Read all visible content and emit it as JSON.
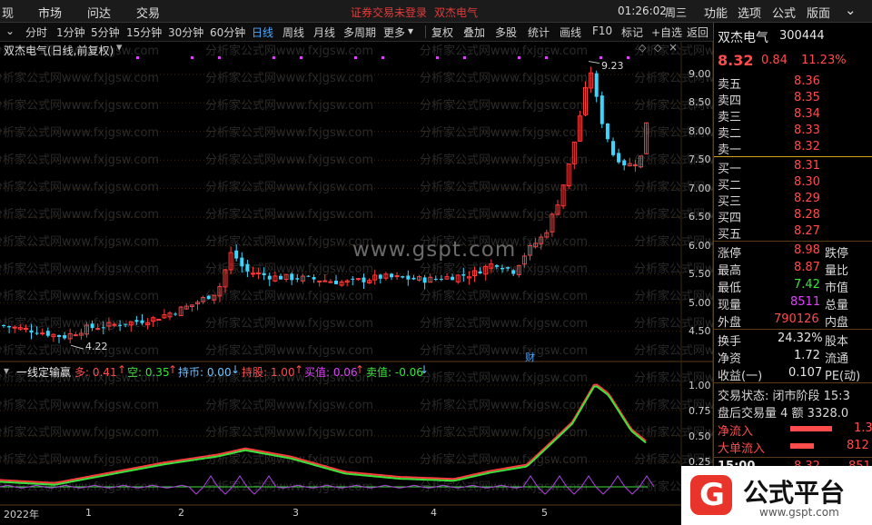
{
  "menubar": {
    "items": [
      "现",
      "市场",
      "问达",
      "交易"
    ],
    "notice": "证券交易未登录",
    "stock_name": "双杰电气",
    "time": "01:26:02",
    "weekday": "周三",
    "right_items": [
      "功能",
      "选项",
      "公式",
      "版面"
    ]
  },
  "toolbar": {
    "periods": [
      "分时",
      "1分钟",
      "5分钟",
      "15分钟",
      "30分钟",
      "60分钟",
      "日线",
      "周线",
      "月线",
      "多周期",
      "更多"
    ],
    "active_period": "日线",
    "tools": [
      "复权",
      "叠加",
      "多股",
      "统计",
      "画线",
      "F10",
      "标记",
      "+自选",
      "返回"
    ]
  },
  "chart_header": {
    "title": "双杰电气(日线,前复权)"
  },
  "indicator_header": {
    "name": "一线定输赢",
    "duo": "多: 0.41",
    "kong": "空: 0.35",
    "chibi": "持币: 0.00",
    "chigu": "持股: 1.00",
    "maizhi": "买值: 0.06",
    "maizhi2": "卖值: -0.06"
  },
  "watermark": "www.gspt.com",
  "bg_watermark": "分析家公式网www.fxjgsw.com",
  "price_annotations": {
    "high": "9.23",
    "low": "4.22",
    "cai": "财"
  },
  "y_axis_price": [
    "9.00",
    "8.50",
    "8.00",
    "7.50",
    "7.00",
    "6.50",
    "6.00",
    "5.50",
    "5.00",
    "4.50"
  ],
  "y_axis_ind": [
    "1.00",
    "0.75",
    "0.50",
    "0.25"
  ],
  "x_axis": [
    "2022年",
    "1",
    "2",
    "3",
    "4",
    "5"
  ],
  "quote": {
    "name": "双杰电气",
    "code": "300444",
    "price": "8.32",
    "change": "0.84",
    "pct": "11.23%",
    "sell": [
      {
        "label": "卖五",
        "price": "8.36"
      },
      {
        "label": "卖四",
        "price": "8.35"
      },
      {
        "label": "卖三",
        "price": "8.34"
      },
      {
        "label": "卖二",
        "price": "8.33"
      },
      {
        "label": "卖一",
        "price": "8.32"
      }
    ],
    "buy": [
      {
        "label": "买一",
        "price": "8.31"
      },
      {
        "label": "买二",
        "price": "8.30"
      },
      {
        "label": "买三",
        "price": "8.29"
      },
      {
        "label": "买四",
        "price": "8.28"
      },
      {
        "label": "买五",
        "price": "8.27"
      }
    ],
    "stats": [
      {
        "l1": "涨停",
        "v": "8.98",
        "l2": "跌停",
        "c": "red"
      },
      {
        "l1": "最高",
        "v": "8.87",
        "l2": "量比",
        "c": "red"
      },
      {
        "l1": "最低",
        "v": "7.42",
        "l2": "市值",
        "c": "grn"
      },
      {
        "l1": "现量",
        "v": "8511",
        "l2": "总量",
        "c": "mag"
      },
      {
        "l1": "外盘",
        "v": "790126",
        "l2": "内盘",
        "c": "red"
      }
    ],
    "stats2": [
      {
        "l1": "换手",
        "v": "24.32%",
        "l2": "股本"
      },
      {
        "l1": "净资",
        "v": "1.72",
        "l2": "流通"
      },
      {
        "l1": "收益(一)",
        "v": "0.107",
        "l2": "PE(动)"
      }
    ],
    "trade_status": "交易状态: 闭市阶段 15:3",
    "after_trade": "盘后交易量 4 额 3328.0",
    "net_in": "净流入",
    "net_in_val": "1.3",
    "big_in": "大单流入",
    "big_in_val": "812",
    "tick_time": "15:00",
    "tick_price": "8.32",
    "tick_vol": "851"
  },
  "logo": {
    "text": "公式平台",
    "url": "www.gspt.com",
    "mark": "G"
  }
}
